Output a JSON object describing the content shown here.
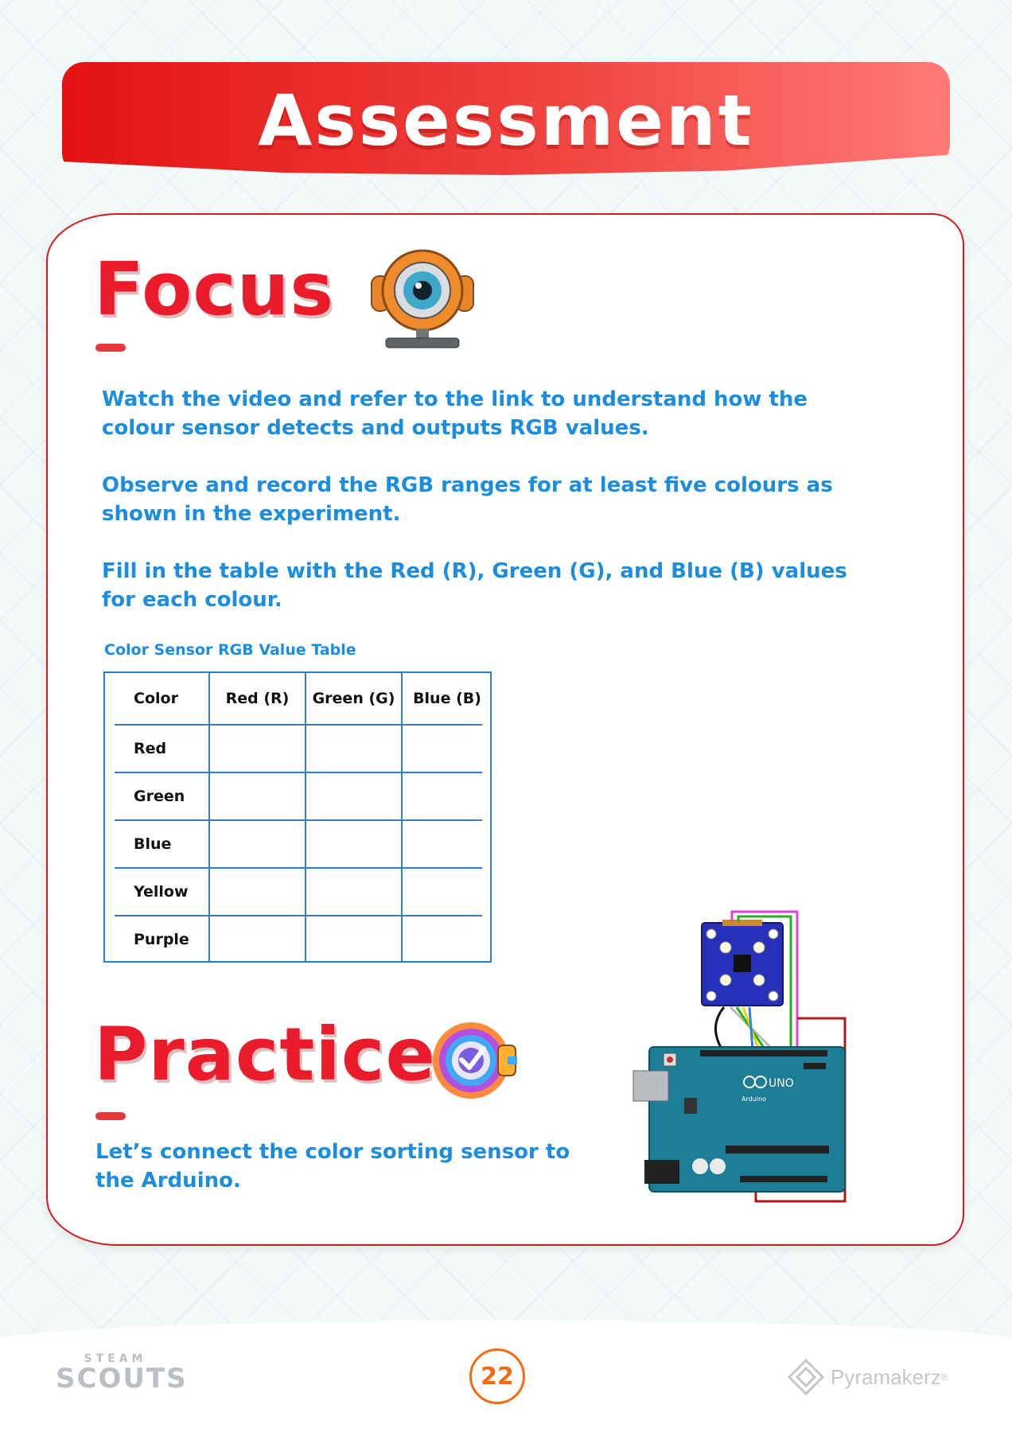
{
  "header": {
    "title": "Assessment"
  },
  "focus": {
    "heading": "Focus",
    "icon": "webcam-robot-icon",
    "instructions": [
      "Watch the video and refer to the link to understand how the colour sensor detects and outputs RGB values.",
      "Observe and record the RGB ranges for at least five colours as shown in the experiment.",
      "Fill in the table with the Red (R), Green (G), and Blue (B) values for each colour."
    ]
  },
  "table": {
    "caption": "Color Sensor RGB Value Table",
    "headers": [
      "Color",
      "Red (R)",
      "Green (G)",
      "Blue (B)"
    ],
    "rows": [
      "Red",
      "Green",
      "Blue",
      "Yellow",
      "Purple"
    ]
  },
  "practice": {
    "heading": "Practice",
    "icon": "target-check-icon",
    "text": "Let’s connect the color sorting sensor to the Arduino."
  },
  "diagram": {
    "board_label": "UNO",
    "brand": "Arduino",
    "wire_colors": [
      "#111111",
      "#e8d400",
      "#2d7df5",
      "#b8b8b8",
      "#20b020",
      "#e040e0",
      "#b01818"
    ]
  },
  "footer": {
    "steam_top": "STEAM",
    "steam_main": "SCOUTS",
    "page_number": "22",
    "brand": "Pyramakerz",
    "brand_mark": "®"
  }
}
